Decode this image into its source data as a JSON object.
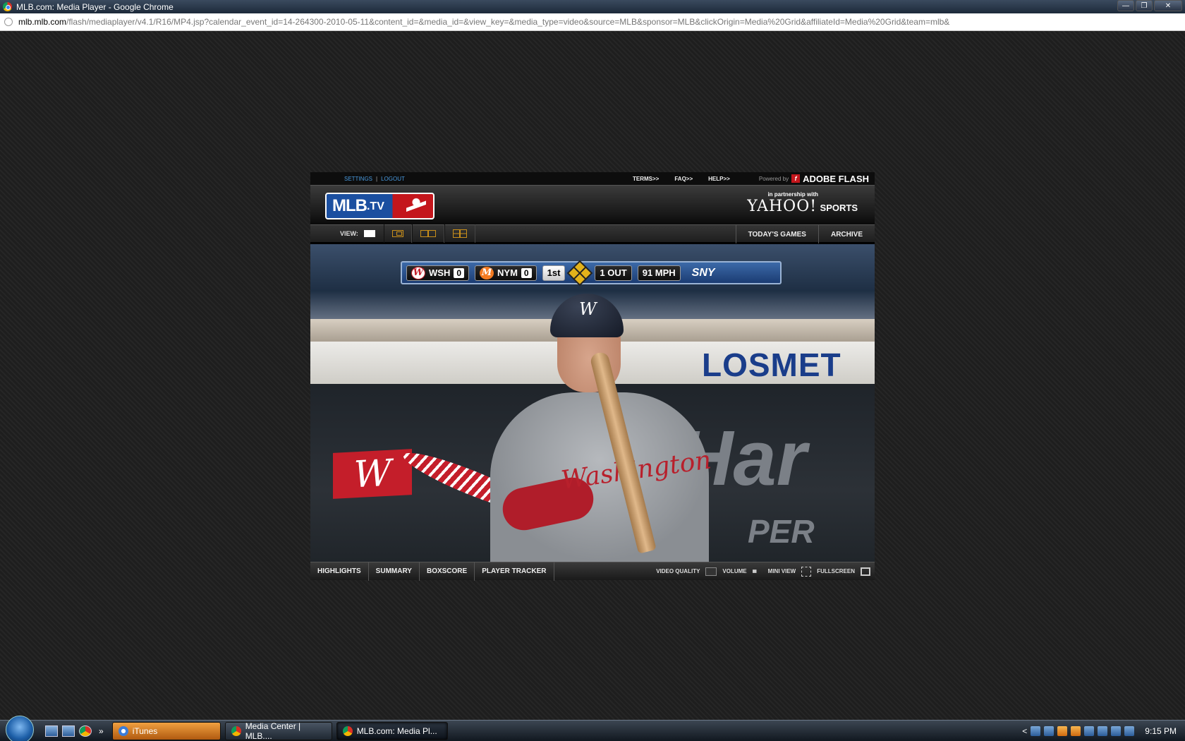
{
  "window": {
    "title": "MLB.com: Media Player - Google Chrome",
    "minimize": "—",
    "maximize": "❐",
    "close": "✕"
  },
  "address": {
    "host": "mlb.mlb.com",
    "path": "/flash/mediaplayer/v4.1/R16/MP4.jsp?calendar_event_id=14-264300-2010-05-11&content_id=&media_id=&view_key=&media_type=video&source=MLB&sponsor=MLB&clickOrigin=Media%20Grid&affiliateId=Media%20Grid&team=mlb&"
  },
  "topnav": {
    "settings": "SETTINGS",
    "separator": "|",
    "logout": "LOGOUT",
    "links": [
      "TERMS>>",
      "FAQ>>",
      "HELP>>"
    ],
    "powered_by": "Powered by",
    "adobe_flash": "ADOBE FLASH"
  },
  "header": {
    "logo_mlb": "MLB",
    "logo_tv": ".TV",
    "partner_label": "in partnership with",
    "yahoo": "YAHOO!",
    "sports": "SPORTS"
  },
  "viewbar": {
    "view_label": "VIEW:",
    "tabs": [
      "TODAY'S GAMES",
      "ARCHIVE"
    ]
  },
  "scorebug": {
    "away_team": "WSH",
    "away_score": "0",
    "home_team": "NYM",
    "home_score": "0",
    "inning": "1st",
    "outs": "1 OUT",
    "pitch_speed": "91 MPH",
    "network": "SNY"
  },
  "video": {
    "ad_top": "LOSMET",
    "ad_big": "Har",
    "ad_per": "PER",
    "jersey_script": "Washington"
  },
  "bottombar": {
    "tabs": [
      "HIGHLIGHTS",
      "SUMMARY",
      "BOXSCORE",
      "PLAYER TRACKER"
    ],
    "video_quality": "VIDEO QUALITY",
    "volume": "VOLUME",
    "mini_view": "MINI VIEW",
    "fullscreen": "FULLSCREEN"
  },
  "taskbar": {
    "more": "»",
    "items": [
      "iTunes",
      "Media Center | MLB....",
      "MLB.com: Media Pl..."
    ],
    "tray_arrow": "<",
    "clock": "9:15 PM"
  }
}
